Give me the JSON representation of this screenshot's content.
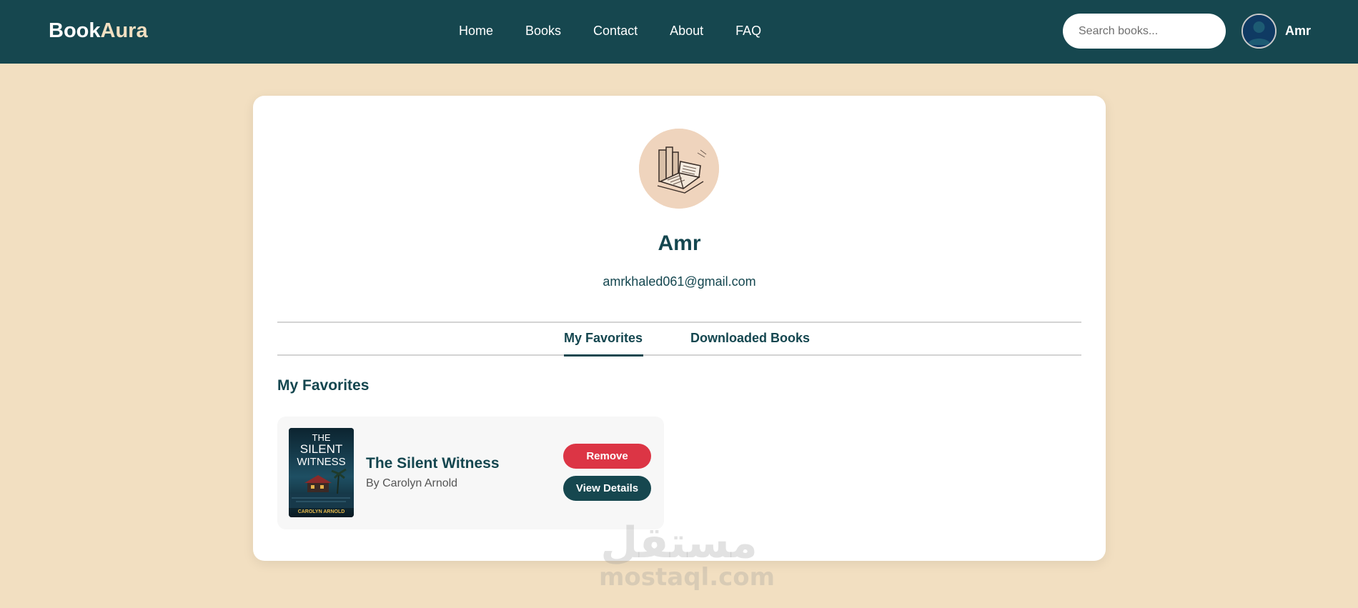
{
  "navbar": {
    "brand_main": "Book",
    "brand_accent": "Aura",
    "links": [
      "Home",
      "Books",
      "Contact",
      "About",
      "FAQ"
    ],
    "search_placeholder": "Search books...",
    "username": "Amr",
    "avatar_icon": "user-avatar-icon"
  },
  "profile": {
    "photo_icon": "open-book-illustration",
    "name": "Amr",
    "email": "amrkhaled061@gmail.com"
  },
  "tabs": [
    {
      "label": "My Favorites",
      "active": true
    },
    {
      "label": "Downloaded Books",
      "active": false
    }
  ],
  "favorites": {
    "section_title": "My Favorites",
    "items": [
      {
        "title": "The Silent Witness",
        "author": "By Carolyn Arnold",
        "cover_text": {
          "line1": "THE",
          "line2": "SILENT",
          "line3": "WITNESS",
          "author": "CAROLYN ARNOLD"
        },
        "remove_label": "Remove",
        "details_label": "View Details"
      }
    ]
  },
  "watermark": {
    "arabic": "مستقل",
    "latin": "mostaql.com"
  },
  "colors": {
    "background": "#f2dfc1",
    "navbar": "#16474f",
    "primary_text": "#14464f",
    "remove_button": "#dc3545",
    "details_button": "#16474f"
  }
}
